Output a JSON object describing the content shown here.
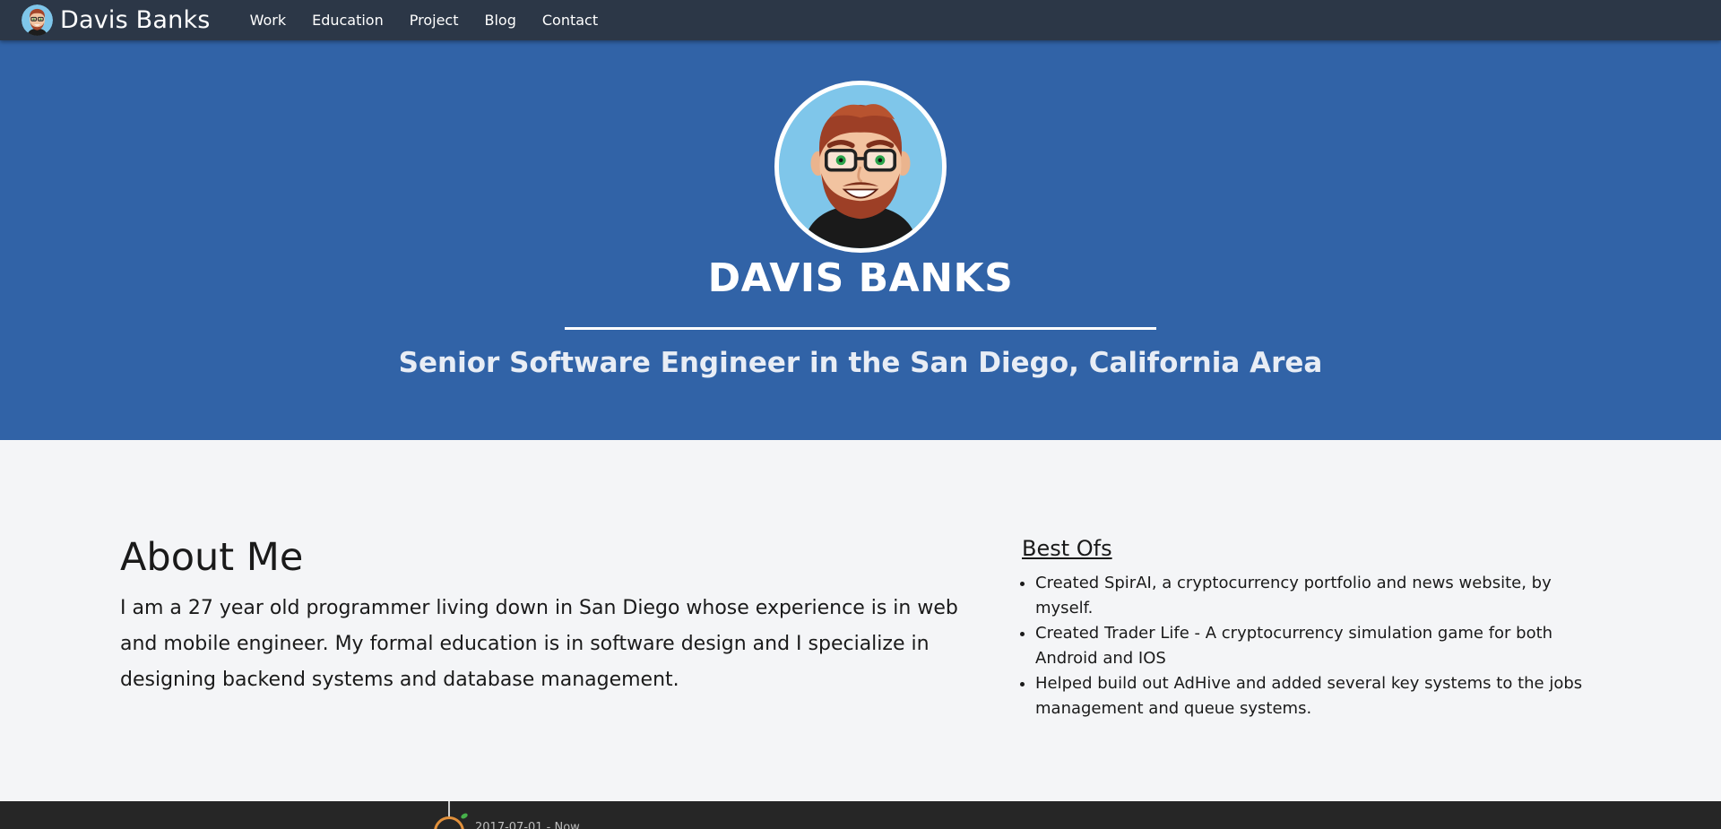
{
  "nav": {
    "brand": "Davis Banks",
    "links": [
      "Work",
      "Education",
      "Project",
      "Blog",
      "Contact"
    ]
  },
  "hero": {
    "name": "DAVIS BANKS",
    "subtitle": "Senior Software Engineer in the San Diego, California Area"
  },
  "about": {
    "title": "About Me",
    "body": "I am a 27 year old programmer living down in San Diego whose experience is in web and mobile engineer. My formal education is in software design and I specialize in designing backend systems and database management."
  },
  "best_ofs": {
    "title": "Best Ofs",
    "items": [
      "Created SpirAI, a cryptocurrency portfolio and news website, by myself.",
      "Created Trader Life - A cryptocurrency simulation game for both Android and IOS",
      "Helped build out AdHive and added several key systems to the jobs management and queue systems."
    ]
  },
  "timeline": {
    "first_date": "2017-07-01 - Now"
  },
  "colors": {
    "navbar": "#2c3747",
    "hero": "#3163a7",
    "page_bg": "#f4f5f7",
    "timeline_bg": "#262626",
    "timeline_dot": "#e1903b"
  },
  "icons": {
    "brand_logo": "avatar-cartoon-icon",
    "hero_avatar": "avatar-cartoon-icon"
  }
}
